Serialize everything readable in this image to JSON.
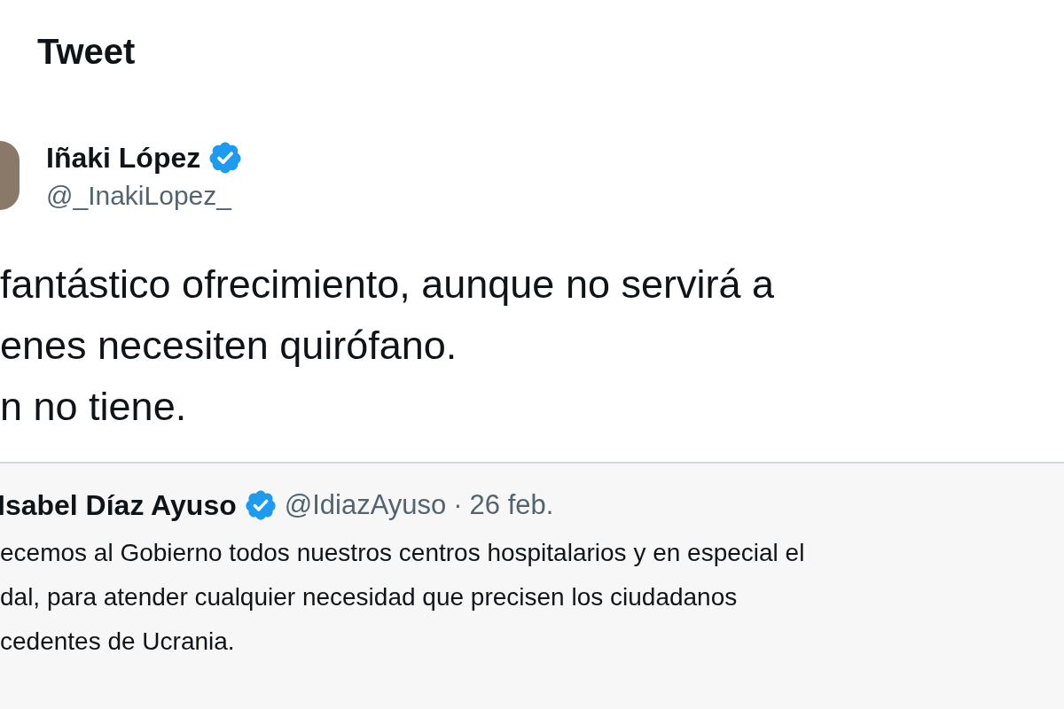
{
  "header": {
    "title": "Tweet"
  },
  "author": {
    "name": "Iñaki López",
    "verified": true,
    "handle": "@_InakiLopez_"
  },
  "tweet_lines": [
    "fantástico ofrecimiento, aunque no servirá a",
    "enes necesiten quirófano.",
    "n no tiene."
  ],
  "quoted_tweet": {
    "name": "Isabel Díaz Ayuso",
    "verified": true,
    "handle": "@IdiazAyuso",
    "separator": "·",
    "date": "26 feb.",
    "lines": [
      "ecemos al Gobierno todos nuestros centros hospitalarios y en especial el",
      "dal, para atender cualquier necesidad que precisen los ciudadanos",
      "cedentes de Ucrania."
    ]
  }
}
